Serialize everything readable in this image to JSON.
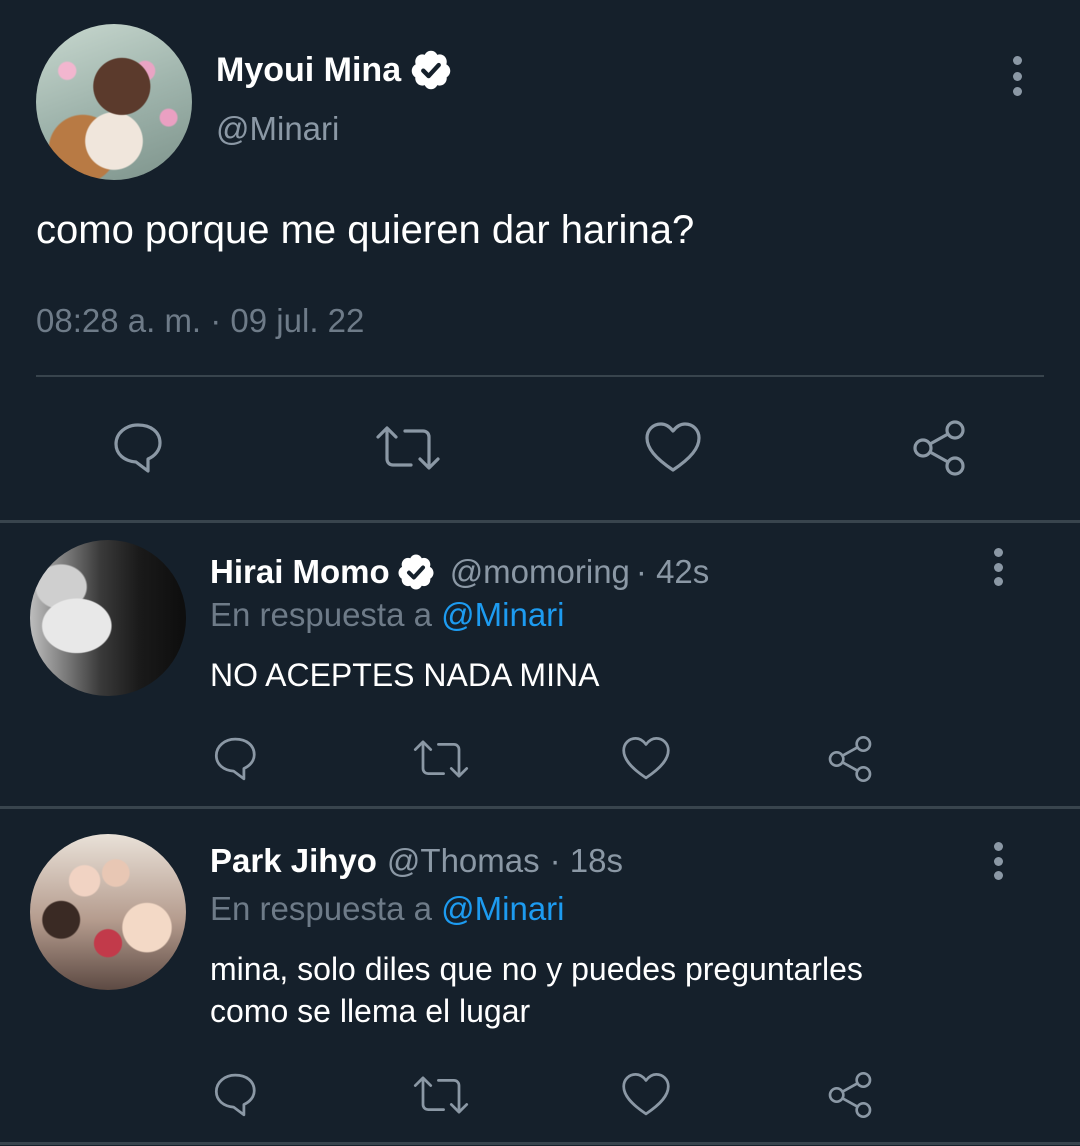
{
  "main_tweet": {
    "author_name": "Myoui Mina",
    "author_handle": "@Minari",
    "text": "como porque me quieren dar harina?",
    "timestamp": "08:28 a. m. · 09 jul. 22",
    "verified": true
  },
  "replies": [
    {
      "author_name": "Hirai Momo",
      "author_handle": "@momoring",
      "time": "· 42s",
      "verified": true,
      "replying_prefix": "En respuesta a",
      "replying_to": "@Minari",
      "text": "NO ACEPTES NADA MINA"
    },
    {
      "author_name": "Park Jihyo",
      "author_handle": "@Thomas",
      "time": "· 18s",
      "verified": false,
      "replying_prefix": "En respuesta a",
      "replying_to": "@Minari",
      "text_line1": "mina, solo diles que no y puedes preguntarles",
      "text_line2": "como se llema el lugar"
    }
  ],
  "icons": {
    "reply": "speech-bubble-icon",
    "retweet": "retweet-icon",
    "like": "heart-icon",
    "share": "share-icon",
    "menu": "vertical-dots-icon",
    "verified": "verified-badge-icon"
  },
  "colors": {
    "background": "#15202b",
    "link": "#1d9bf0",
    "muted": "#8b98a5",
    "divider": "#38444d"
  }
}
